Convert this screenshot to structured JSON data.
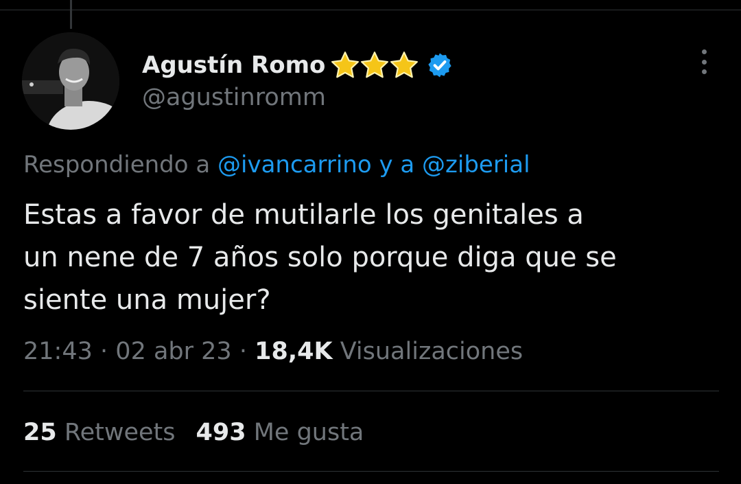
{
  "tweet": {
    "author": {
      "display_name": "Agustín Romo",
      "handle": "@agustinromm",
      "badge_stars": 3,
      "verified": true
    },
    "reply_to": {
      "prefix": "Respondiendo a",
      "mention_1": "@ivancarrino",
      "conjunction": "y a",
      "mention_2": "@ziberial"
    },
    "text_lines": [
      "Estas a favor de mutilarle los genitales a",
      "un nene de 7 años solo porque diga que se",
      "siente una mujer?"
    ],
    "time": "21:43",
    "separator": "·",
    "date": "02 abr 23",
    "views_count": "18,4K",
    "views_label": "Visualizaciones",
    "retweets_count": "25",
    "retweets_label": "Retweets",
    "likes_count": "493",
    "likes_label": "Me gusta"
  },
  "colors": {
    "background": "#000000",
    "text_primary": "#e7e9ea",
    "text_secondary": "#71767b",
    "accent": "#1d9bf0",
    "star": "#f5c518",
    "divider": "#2f3336"
  },
  "icons": {
    "more": "more-vertical-icon",
    "verified": "verified-badge-icon",
    "star": "star-icon"
  }
}
